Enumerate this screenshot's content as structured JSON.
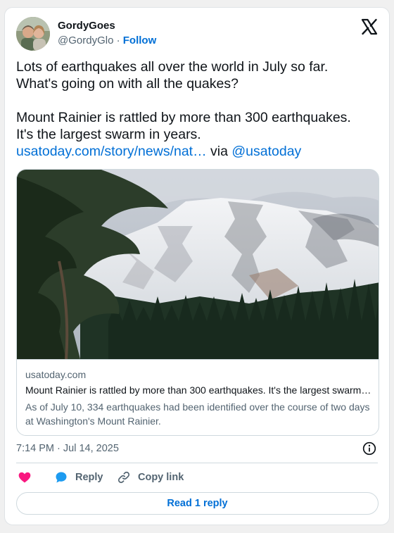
{
  "author": {
    "name": "GordyGoes",
    "handle": "@GordyGlo",
    "separator": "·",
    "follow_label": "Follow"
  },
  "tweet": {
    "line1": "Lots of earthquakes all over the world in July so far.",
    "line2": "What's going on with all the quakes?",
    "line3": "Mount Rainier is rattled by more than 300 earthquakes.",
    "line4": "It's the largest swarm in years.",
    "link_text": "usatoday.com/story/news/nat…",
    "via_text": " via ",
    "mention": "@usatoday"
  },
  "link_card": {
    "domain": "usatoday.com",
    "title": "Mount Rainier is rattled by more than 300 earthquakes. It's the largest swarm in years.",
    "description": "As of July 10, 334 earthquakes had been identified over the course of two days at Washington's Mount Rainier."
  },
  "timestamp": "7:14 PM · Jul 14, 2025",
  "actions": {
    "reply_label": "Reply",
    "copy_link_label": "Copy link"
  },
  "read_replies_label": "Read 1 reply",
  "icons": [
    "avatar-photo",
    "x-logo-icon",
    "info-icon",
    "heart-icon",
    "reply-bubble-icon",
    "link-icon"
  ],
  "colors": {
    "link": "#006fd6",
    "secondary_text": "#536471",
    "heart": "#f91880",
    "reply_bubble": "#1d9bf0"
  }
}
